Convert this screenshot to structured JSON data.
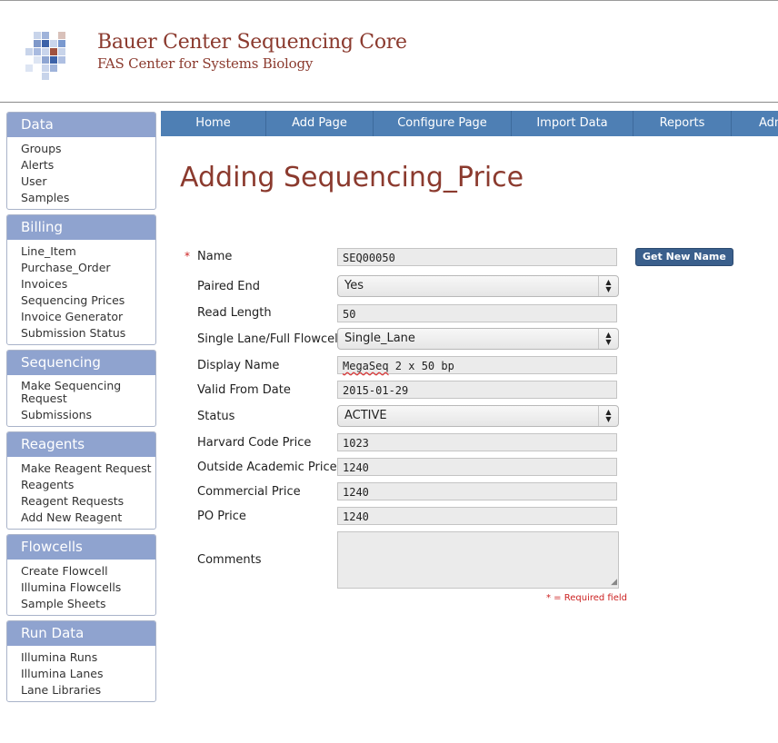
{
  "brand": {
    "title": "Bauer Center Sequencing Core",
    "subtitle": "FAS Center for Systems Biology"
  },
  "sidebar": {
    "groups": [
      {
        "title": "Data",
        "items": [
          "Groups",
          "Alerts",
          "User",
          "Samples"
        ]
      },
      {
        "title": "Billing",
        "items": [
          "Line_Item",
          "Purchase_Order",
          "Invoices",
          "Sequencing Prices",
          "Invoice Generator",
          "Submission Status"
        ]
      },
      {
        "title": "Sequencing",
        "items": [
          "Make Sequencing Request",
          "Submissions"
        ]
      },
      {
        "title": "Reagents",
        "items": [
          "Make Reagent Request",
          "Reagents",
          "Reagent Requests",
          "Add New Reagent"
        ]
      },
      {
        "title": "Flowcells",
        "items": [
          "Create Flowcell",
          "Illumina Flowcells",
          "Sample Sheets"
        ]
      },
      {
        "title": "Run Data",
        "items": [
          "Illumina Runs",
          "Illumina Lanes",
          "Lane Libraries"
        ]
      }
    ]
  },
  "nav": [
    "Home",
    "Add Page",
    "Configure Page",
    "Import Data",
    "Reports",
    "Adm"
  ],
  "page_title": "Adding Sequencing_Price",
  "form": {
    "name": {
      "label": "Name",
      "value": "SEQ00050",
      "required_mark": "*"
    },
    "get_name_button": "Get New Name",
    "paired_end": {
      "label": "Paired End",
      "value": "Yes"
    },
    "read_length": {
      "label": "Read Length",
      "value": "50"
    },
    "lane_type": {
      "label": "Single Lane/Full Flowcell",
      "value": "Single_Lane"
    },
    "display_name": {
      "label": "Display Name",
      "value_word": "MegaSeq",
      "value_rest": " 2 x 50 bp"
    },
    "valid_from": {
      "label": "Valid From Date",
      "value": "2015-01-29"
    },
    "status": {
      "label": "Status",
      "value": "ACTIVE"
    },
    "harvard_price": {
      "label": "Harvard Code Price",
      "value": "1023"
    },
    "outside_price": {
      "label": "Outside Academic Price",
      "value": "1240"
    },
    "commercial_price": {
      "label": "Commercial Price",
      "value": "1240"
    },
    "po_price": {
      "label": "PO Price",
      "value": "1240"
    },
    "comments": {
      "label": "Comments",
      "value": ""
    },
    "required_note": "* = Required field"
  },
  "colors": {
    "brand": "#8b3a2e",
    "nav": "#4e7fb4",
    "sidebar_head": "#8fa3cf",
    "required": "#cc2222"
  }
}
